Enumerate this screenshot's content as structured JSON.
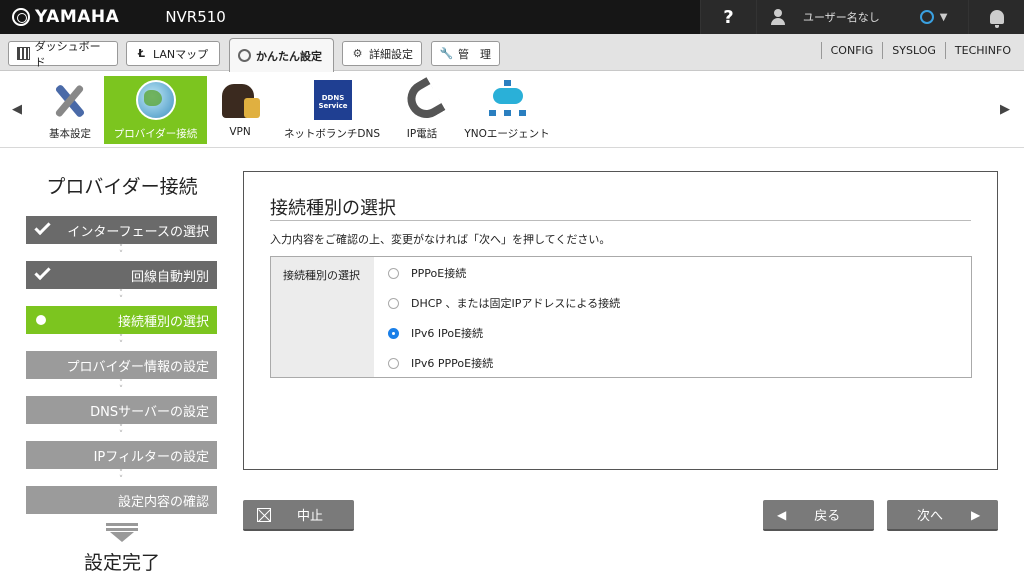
{
  "header": {
    "brand": "YAMAHA",
    "model": "NVR510",
    "help": "?",
    "user": "ユーザー名なし"
  },
  "menu": {
    "tabs": [
      {
        "label": "ダッシュボード",
        "icon": "dashboard-icon"
      },
      {
        "label": "LANマップ",
        "icon": "lan-map-icon"
      },
      {
        "label": "かんたん設定",
        "icon": "key-icon",
        "active": true
      },
      {
        "label": "詳細設定",
        "icon": "gear-icon"
      },
      {
        "label": "管　理",
        "icon": "wrench-icon"
      }
    ],
    "links": [
      "CONFIG",
      "SYSLOG",
      "TECHINFO"
    ]
  },
  "toolbar": {
    "items": [
      {
        "label": "基本設定",
        "icon": "tools-icon"
      },
      {
        "label": "プロバイダー接続",
        "icon": "globe-icon",
        "active": true
      },
      {
        "label": "VPN",
        "icon": "vpn-lock-icon"
      },
      {
        "label": "ネットボランチDNS",
        "icon": "ddns-icon"
      },
      {
        "label": "IP電話",
        "icon": "phone-icon"
      },
      {
        "label": "YNOエージェント",
        "icon": "network-icon"
      }
    ],
    "ddns_icon_text": "DDNS Service"
  },
  "wizard": {
    "title": "プロバイダー接続",
    "steps": [
      {
        "label": "インターフェースの選択",
        "state": "done"
      },
      {
        "label": "回線自動判別",
        "state": "done"
      },
      {
        "label": "接続種別の選択",
        "state": "current"
      },
      {
        "label": "プロバイダー情報の設定",
        "state": "todo"
      },
      {
        "label": "DNSサーバーの設定",
        "state": "todo"
      },
      {
        "label": "IPフィルターの設定",
        "state": "todo"
      },
      {
        "label": "設定内容の確認",
        "state": "todo"
      }
    ],
    "final": "設定完了"
  },
  "panel": {
    "title": "接続種別の選択",
    "description": "入力内容をご確認の上、変更がなければ「次へ」を押してください。",
    "field_label": "接続種別の選択",
    "options": [
      {
        "label": "PPPoE接続",
        "selected": false
      },
      {
        "label": "DHCP 、または固定IPアドレスによる接続",
        "selected": false
      },
      {
        "label": "IPv6 IPoE接続",
        "selected": true
      },
      {
        "label": "IPv6 PPPoE接続",
        "selected": false
      }
    ]
  },
  "buttons": {
    "cancel": "中止",
    "back": "戻る",
    "next": "次へ"
  },
  "colors": {
    "accent_green": "#7cc51f",
    "radio_blue": "#1a7fe8"
  }
}
